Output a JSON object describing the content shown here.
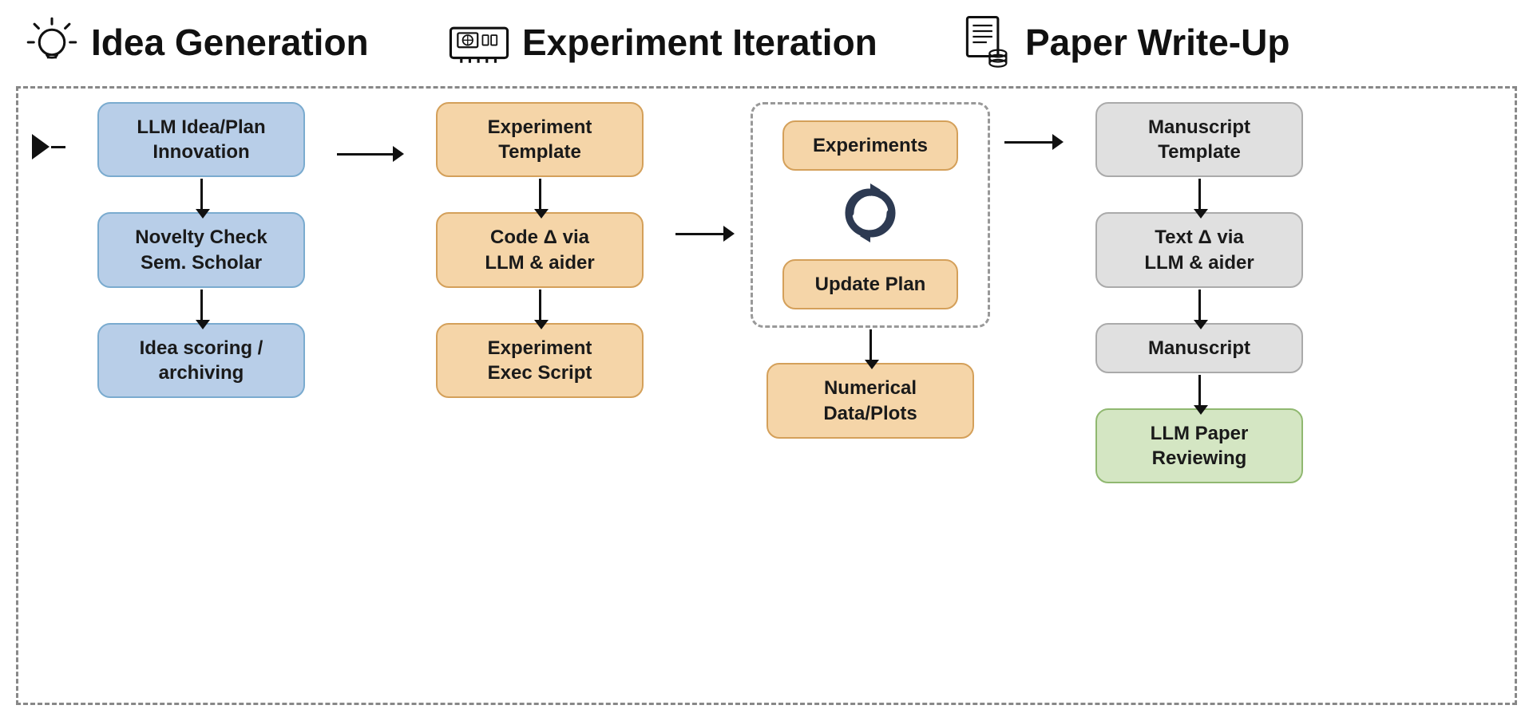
{
  "sections": [
    {
      "id": "idea-generation",
      "title": "Idea Generation",
      "icon": "bulb"
    },
    {
      "id": "experiment-iteration",
      "title": "Experiment Iteration",
      "icon": "gpu"
    },
    {
      "id": "paper-writeup",
      "title": "Paper Write-Up",
      "icon": "paper"
    }
  ],
  "idea_column": {
    "boxes": [
      {
        "id": "llm-idea",
        "label": "LLM Idea/Plan\nInnovation",
        "style": "blue"
      },
      {
        "id": "novelty-check",
        "label": "Novelty Check\nSem. Scholar",
        "style": "blue"
      },
      {
        "id": "idea-scoring",
        "label": "Idea scoring /\narchiving",
        "style": "blue"
      }
    ]
  },
  "experiment_column": {
    "boxes": [
      {
        "id": "exp-template",
        "label": "Experiment\nTemplate",
        "style": "orange"
      },
      {
        "id": "code-delta",
        "label": "Code Δ via\nLLM & aider",
        "style": "orange"
      },
      {
        "id": "exp-exec",
        "label": "Experiment\nExec Script",
        "style": "orange"
      }
    ]
  },
  "iteration_column": {
    "dashed_box": {
      "boxes": [
        {
          "id": "experiments",
          "label": "Experiments",
          "style": "orange"
        },
        {
          "id": "update-plan",
          "label": "Update Plan",
          "style": "orange"
        }
      ]
    },
    "bottom_box": {
      "id": "numerical-data",
      "label": "Numerical\nData/Plots",
      "style": "orange"
    }
  },
  "paper_column": {
    "boxes": [
      {
        "id": "manuscript-template",
        "label": "Manuscript\nTemplate",
        "style": "gray"
      },
      {
        "id": "text-delta",
        "label": "Text Δ via\nLLM & aider",
        "style": "gray"
      },
      {
        "id": "manuscript",
        "label": "Manuscript",
        "style": "gray"
      },
      {
        "id": "llm-reviewing",
        "label": "LLM Paper\nReviewing",
        "style": "green"
      }
    ]
  }
}
